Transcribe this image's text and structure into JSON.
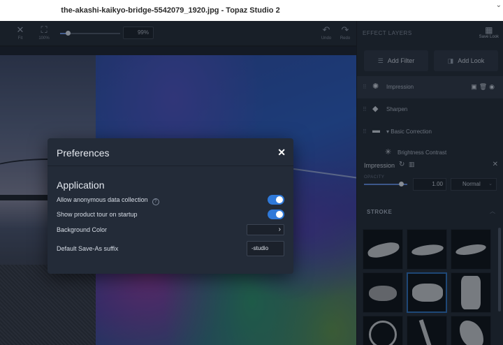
{
  "window": {
    "title": "the-akashi-kaikyo-bridge-5542079_1920.jpg - Topaz Studio 2",
    "corner_glyph": "⌄"
  },
  "toolbar": {
    "fit_label": "Fit",
    "actual_label": "100%",
    "zoom_value": "99%",
    "zoom_slider_level": 0.1,
    "undo_label": "Undo",
    "redo_label": "Redo"
  },
  "panel": {
    "header": "EFFECT LAYERS",
    "save_look_label": "Save Look",
    "add_filter_label": "Add Filter",
    "add_look_label": "Add Look",
    "layers": [
      {
        "name": "Impression",
        "icon": "impression-icon",
        "active": true
      },
      {
        "name": "Sharpen",
        "icon": "sharpen-icon",
        "active": false
      },
      {
        "name": "▾ Basic Correction",
        "icon": "folder-icon",
        "active": false
      },
      {
        "name": "Brightness Contrast",
        "icon": "sun-icon",
        "active": false
      }
    ],
    "filter": {
      "name": "Impression",
      "opacity_label": "OPACITY",
      "opacity_value": "1.00",
      "opacity_level": 1.0,
      "blend_mode": "Normal"
    },
    "section": {
      "title": "STROKE"
    }
  },
  "preferences": {
    "title": "Preferences",
    "close_glyph": "✕",
    "section_title": "Application",
    "rows": {
      "anon_data": {
        "label": "Allow anonymous data collection",
        "enabled": true
      },
      "product_tour": {
        "label": "Show product tour on startup",
        "enabled": true
      },
      "bg_color": {
        "label": "Background Color",
        "value_color": "#14181f"
      },
      "save_suffix": {
        "label": "Default Save-As suffix",
        "value": "-studio"
      }
    }
  },
  "colors": {
    "accent": "#2f79d9",
    "panel_bg": "#232a36",
    "modal_bg": "#232b38"
  }
}
